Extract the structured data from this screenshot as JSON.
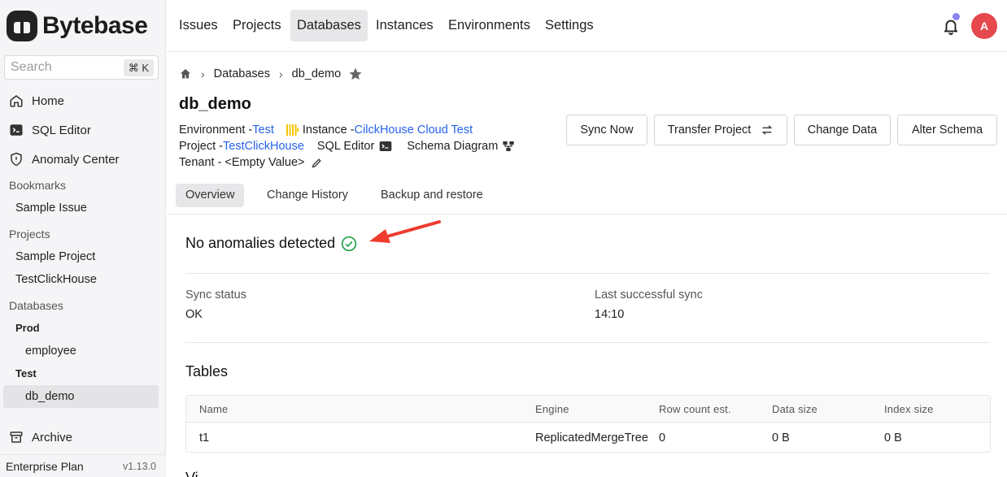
{
  "app": {
    "name": "Bytebase"
  },
  "search": {
    "placeholder": "Search",
    "shortcut": "⌘ K"
  },
  "sidebar": {
    "nav": [
      {
        "label": "Home",
        "icon": "home-icon"
      },
      {
        "label": "SQL Editor",
        "icon": "terminal-icon"
      },
      {
        "label": "Anomaly Center",
        "icon": "shield-icon"
      }
    ],
    "bookmarks": {
      "title": "Bookmarks",
      "items": [
        "Sample Issue"
      ]
    },
    "projects": {
      "title": "Projects",
      "items": [
        "Sample Project",
        "TestClickHouse"
      ]
    },
    "databases": {
      "title": "Databases",
      "groups": [
        {
          "env": "Prod",
          "items": [
            "employee"
          ]
        },
        {
          "env": "Test",
          "items": [
            "db_demo"
          ]
        }
      ]
    },
    "archive": "Archive",
    "footer": {
      "plan": "Enterprise Plan",
      "version": "v1.13.0"
    }
  },
  "topnav": {
    "items": [
      "Issues",
      "Projects",
      "Databases",
      "Instances",
      "Environments",
      "Settings"
    ],
    "active": "Databases",
    "avatar": "A"
  },
  "breadcrumb": {
    "parent": "Databases",
    "current": "db_demo"
  },
  "database": {
    "name": "db_demo",
    "environment_label": "Environment - ",
    "environment": "Test",
    "instance_label": "Instance - ",
    "instance": "CilckHouse Cloud Test",
    "project_label": "Project - ",
    "project": "TestClickHouse",
    "sql_editor": "SQL Editor",
    "schema_diagram": "Schema Diagram",
    "tenant": "Tenant - <Empty Value>"
  },
  "actions": [
    "Sync Now",
    "Transfer Project",
    "Change Data",
    "Alter Schema"
  ],
  "tabs": [
    "Overview",
    "Change History",
    "Backup and restore"
  ],
  "overview": {
    "anomaly": "No anomalies detected",
    "sync_status_label": "Sync status",
    "sync_status": "OK",
    "last_sync_label": "Last successful sync",
    "last_sync": "14:10",
    "tables_title": "Tables",
    "next_section_title": "Vi"
  },
  "tables": {
    "columns": [
      "Name",
      "Engine",
      "Row count est.",
      "Data size",
      "Index size"
    ],
    "rows": [
      {
        "name": "t1",
        "engine": "ReplicatedMergeTree",
        "rows": "0",
        "data_size": "0 B",
        "index_size": "0 B"
      }
    ]
  },
  "colors": {
    "link": "#2563eb",
    "success": "#22a34a",
    "annotation_arrow": "#f03a2e",
    "avatar": "#e5484d",
    "notification_dot": "#8b84f1"
  }
}
